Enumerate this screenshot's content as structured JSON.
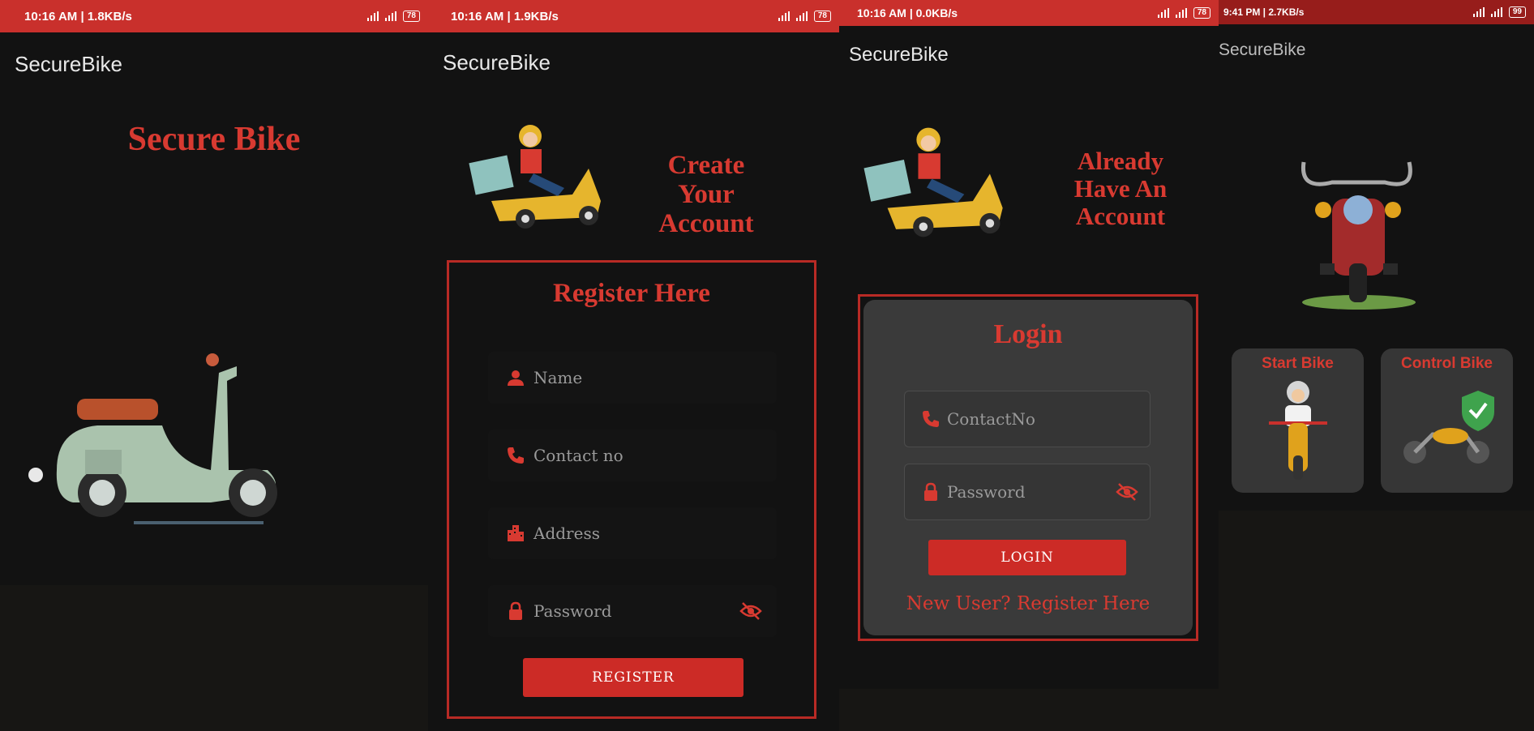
{
  "screens": [
    {
      "status": {
        "time": "10:16 AM | 1.8KB/s",
        "battery": "78"
      },
      "app_title": "SecureBike",
      "heading": "Secure Bike"
    },
    {
      "status": {
        "time": "10:16 AM | 1.9KB/s",
        "battery": "78"
      },
      "app_title": "SecureBike",
      "heading": "Create Your Account",
      "form_title": "Register Here",
      "fields": {
        "name": "Name",
        "contact": "Contact no",
        "address": "Address",
        "password": "Password"
      },
      "button": "REGISTER"
    },
    {
      "status": {
        "time": "10:16 AM | 0.0KB/s",
        "battery": "78"
      },
      "app_title": "SecureBike",
      "heading": "Already Have An Account",
      "form_title": "Login",
      "fields": {
        "contact": "ContactNo",
        "password": "Password"
      },
      "button": "LOGIN",
      "link": "New User? Register Here"
    },
    {
      "status": {
        "time": "9:41 PM | 2.7KB/s",
        "battery": "99"
      },
      "app_title": "SecureBike",
      "cards": {
        "start": "Start Bike",
        "control": "Control Bike"
      }
    }
  ],
  "colors": {
    "accent": "#d83a31",
    "statusbar": "#c9302c",
    "background": "#121212",
    "card": "#3a3a3a"
  },
  "icons": [
    "person-icon",
    "phone-icon",
    "building-icon",
    "lock-icon",
    "eye-off-icon",
    "alarm-off-icon",
    "signal-icon",
    "battery-icon"
  ]
}
